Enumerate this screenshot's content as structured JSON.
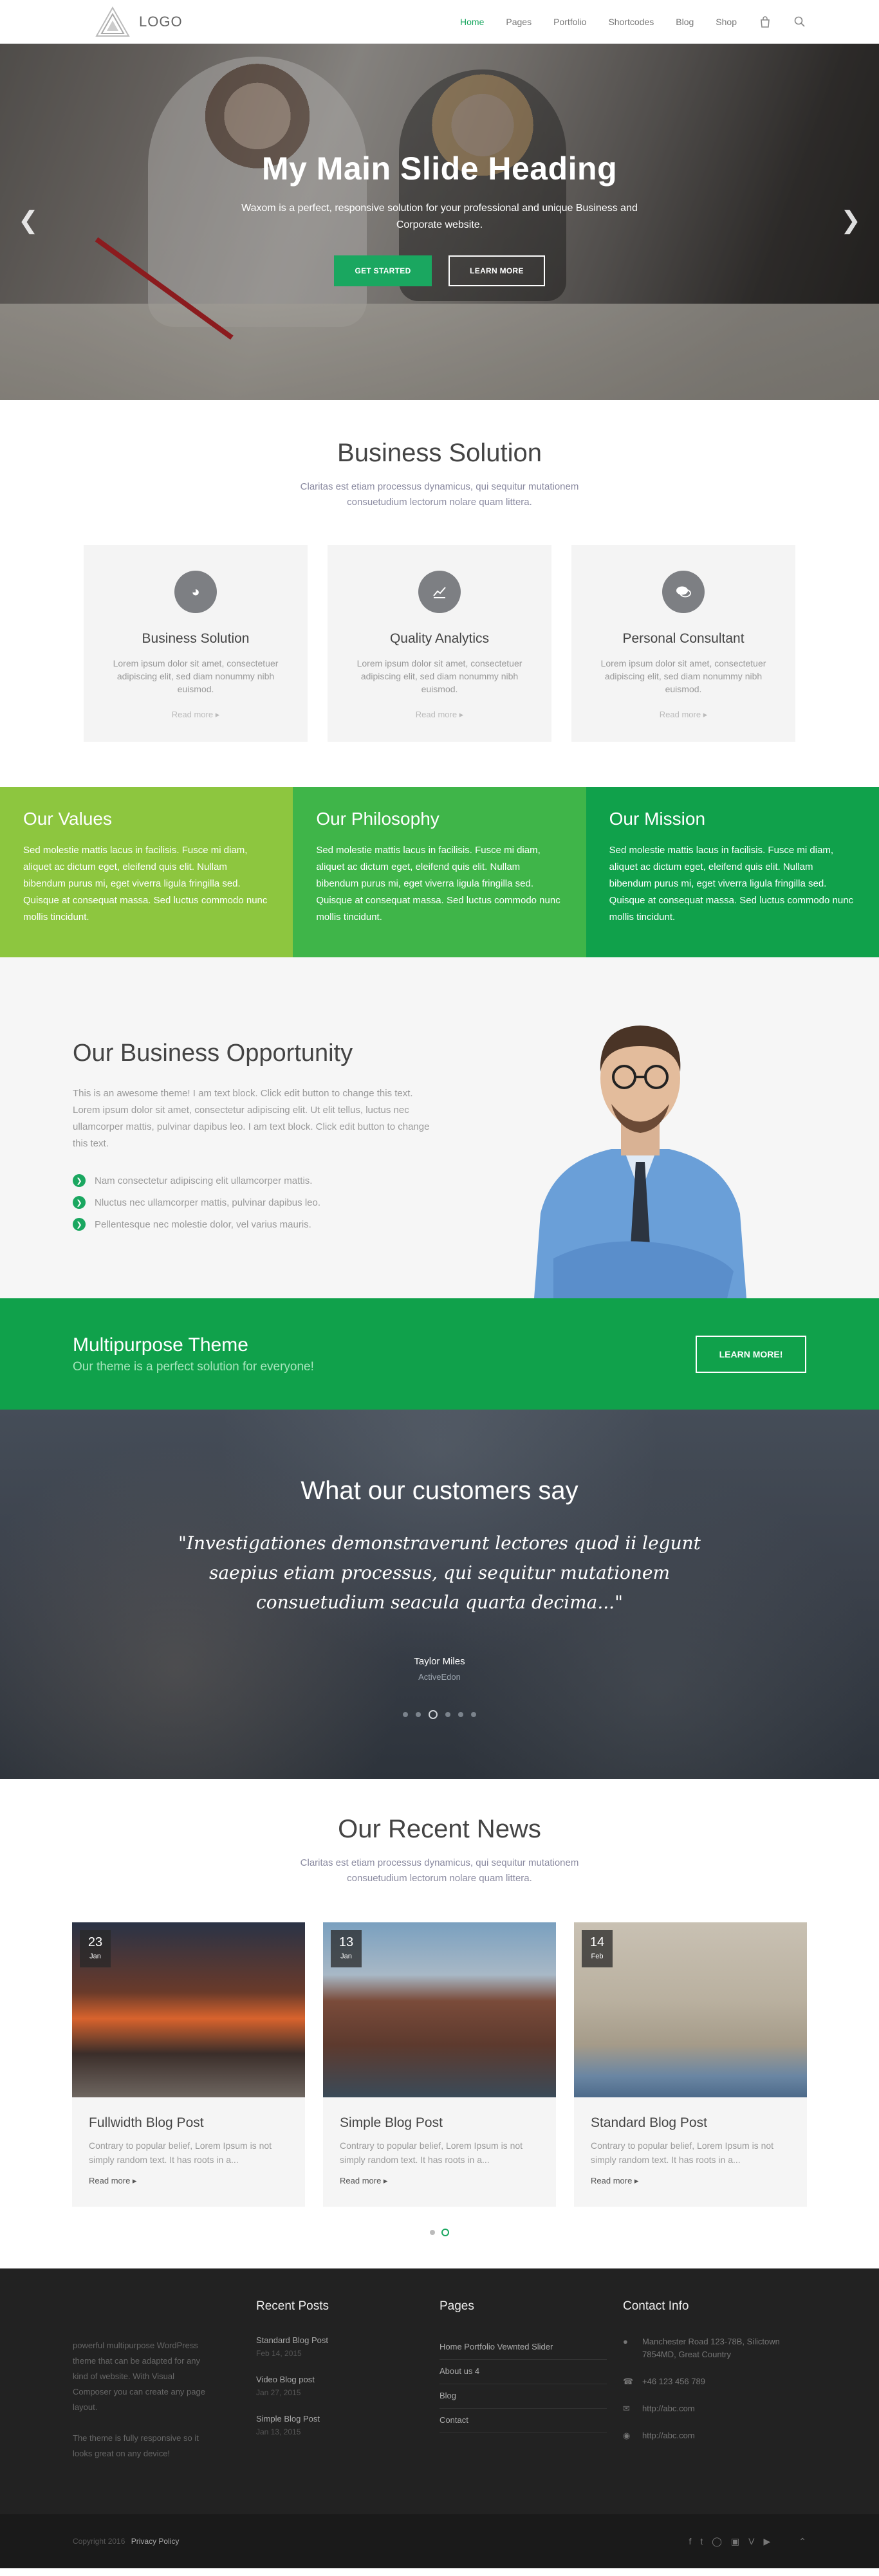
{
  "header": {
    "logo_text": "LOGO",
    "nav": [
      "Home",
      "Pages",
      "Portfolio",
      "Shortcodes",
      "Blog",
      "Shop"
    ]
  },
  "hero": {
    "title": "My Main Slide Heading",
    "subtitle": "Waxom is a perfect, responsive solution for your professional and unique Business and Corporate website.",
    "btn_primary": "GET STARTED",
    "btn_secondary": "LEARN MORE"
  },
  "business": {
    "title": "Business Solution",
    "subtitle": "Claritas est etiam processus dynamicus, qui sequitur mutationem consuetudium lectorum nolare quam littera.",
    "cards": [
      {
        "title": "Business Solution",
        "text": "Lorem ipsum dolor sit amet, consectetuer adipiscing elit, sed diam nonummy nibh euismod.",
        "link": "Read more"
      },
      {
        "title": "Quality Analytics",
        "text": "Lorem ipsum dolor sit amet, consectetuer adipiscing elit, sed diam nonummy nibh euismod.",
        "link": "Read more"
      },
      {
        "title": "Personal Consultant",
        "text": "Lorem ipsum dolor sit amet, consectetuer adipiscing elit, sed diam nonummy nibh euismod.",
        "link": "Read more"
      }
    ]
  },
  "values": [
    {
      "title": "Our Values",
      "text": "Sed molestie mattis lacus in facilisis. Fusce mi diam, aliquet ac dictum eget, eleifend quis elit. Nullam bibendum purus mi, eget viverra ligula fringilla sed. Quisque at consequat massa. Sed luctus commodo nunc mollis tincidunt."
    },
    {
      "title": "Our Philosophy",
      "text": "Sed molestie mattis lacus in facilisis. Fusce mi diam, aliquet ac dictum eget, eleifend quis elit. Nullam bibendum purus mi, eget viverra ligula fringilla sed. Quisque at consequat massa. Sed luctus commodo nunc mollis tincidunt."
    },
    {
      "title": "Our Mission",
      "text": "Sed molestie mattis lacus in facilisis. Fusce mi diam, aliquet ac dictum eget, eleifend quis elit. Nullam bibendum purus mi, eget viverra ligula fringilla sed. Quisque at consequat massa. Sed luctus commodo nunc mollis tincidunt."
    }
  ],
  "opportunity": {
    "title": "Our Business Opportunity",
    "desc": "This is an awesome theme! I am text block. Click edit button to change this text. Lorem ipsum dolor sit amet, consectetur adipiscing elit. Ut elit tellus, luctus nec ullamcorper mattis, pulvinar dapibus leo. I am text block. Click edit button to change this text.",
    "list": [
      "Nam consectetur adipiscing elit ullamcorper mattis.",
      "Nluctus nec ullamcorper mattis, pulvinar dapibus leo.",
      "Pellentesque nec molestie dolor, vel varius mauris."
    ]
  },
  "cta": {
    "title": "Multipurpose Theme",
    "subtitle": "Our theme is a perfect solution for everyone!",
    "button": "LEARN MORE!"
  },
  "testimonial": {
    "title": "What our customers say",
    "quote": "\"Investigationes demonstraverunt lectores quod ii legunt saepius etiam processus, qui sequitur mutationem consuetudium seacula quarta decima...\"",
    "name": "Taylor Miles",
    "role": "ActiveEdon"
  },
  "news": {
    "title": "Our Recent News",
    "subtitle": "Claritas est etiam processus dynamicus, qui sequitur mutationem consuetudium lectorum nolare quam littera.",
    "posts": [
      {
        "day": "23",
        "month": "Jan",
        "title": "Fullwidth Blog Post",
        "text": "Contrary to popular belief, Lorem Ipsum is not simply random text. It has roots in a...",
        "link": "Read more"
      },
      {
        "day": "13",
        "month": "Jan",
        "title": "Simple Blog Post",
        "text": "Contrary to popular belief, Lorem Ipsum is not simply random text. It has roots in a...",
        "link": "Read more"
      },
      {
        "day": "14",
        "month": "Feb",
        "title": "Standard Blog Post",
        "text": "Contrary to popular belief, Lorem Ipsum is not simply random text. It has roots in a...",
        "link": "Read more"
      }
    ]
  },
  "footer": {
    "about_1": "powerful multipurpose WordPress theme that can be adapted for any kind of website. With Visual Composer you can create any page layout.",
    "about_2": "The theme is fully responsive so it looks great on any device!",
    "recent_title": "Recent Posts",
    "recent": [
      {
        "title": "Standard Blog Post",
        "date": "Feb 14, 2015"
      },
      {
        "title": "Video Blog post",
        "date": "Jan 27, 2015"
      },
      {
        "title": "Simple Blog Post",
        "date": "Jan 13, 2015"
      }
    ],
    "pages_title": "Pages",
    "pages": [
      "Home Portfolio Vewnted Slider",
      "About us 4",
      "Blog",
      "Contact"
    ],
    "contact_title": "Contact Info",
    "address": "Manchester Road 123-78B, Silictown 7854MD, Great Country",
    "phone": "+46 123 456 789",
    "email": "http://abc.com",
    "website": "http://abc.com"
  },
  "bottom": {
    "copyright": "Copyright 2016",
    "policy": "Privacy Policy"
  }
}
